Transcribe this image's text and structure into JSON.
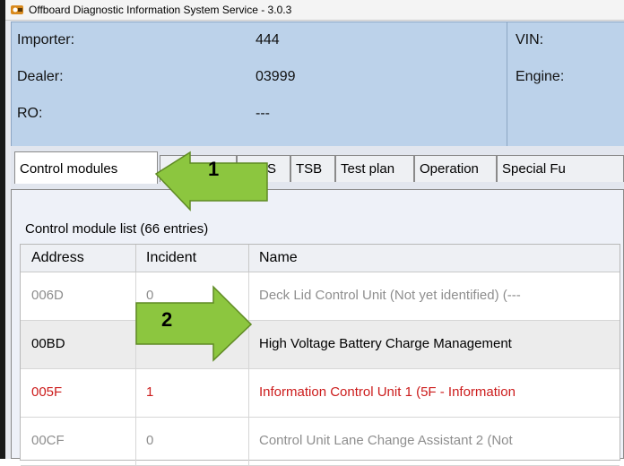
{
  "window": {
    "title": "Offboard Diagnostic Information System Service - 3.0.3",
    "icon": "odis-app-icon"
  },
  "info": {
    "importer_label": "Importer:",
    "importer_value": "444",
    "dealer_label": "Dealer:",
    "dealer_value": "03999",
    "ro_label": "RO:",
    "ro_value": "---",
    "vin_label": "VIN:",
    "engine_label": "Engine:"
  },
  "tabs": [
    {
      "label": "Control modules",
      "active": true
    },
    {
      "label": "...",
      "active": false
    },
    {
      "label": "DISS",
      "active": false
    },
    {
      "label": "TSB",
      "active": false
    },
    {
      "label": "Test plan",
      "active": false
    },
    {
      "label": "Operation",
      "active": false
    },
    {
      "label": "Special Fu",
      "active": false
    }
  ],
  "list": {
    "title": "Control module list (66 entries)",
    "columns": [
      "Address",
      "Incident",
      "Name"
    ],
    "rows": [
      {
        "address": "006D",
        "incident": "0",
        "name": "Deck Lid Control Unit (Not yet identified) (---",
        "state": "grey"
      },
      {
        "address": "00BD",
        "incident": "",
        "name": "High Voltage Battery Charge Management",
        "state": "selected"
      },
      {
        "address": "005F",
        "incident": "1",
        "name": "Information Control Unit 1 (5F - Information",
        "state": "error"
      },
      {
        "address": "00CF",
        "incident": "0",
        "name": "Control Unit Lane Change Assistant 2 (Not",
        "state": "grey"
      }
    ]
  },
  "callouts": [
    {
      "number": "1",
      "color": "#8cc63f"
    },
    {
      "number": "2",
      "color": "#8cc63f"
    }
  ]
}
